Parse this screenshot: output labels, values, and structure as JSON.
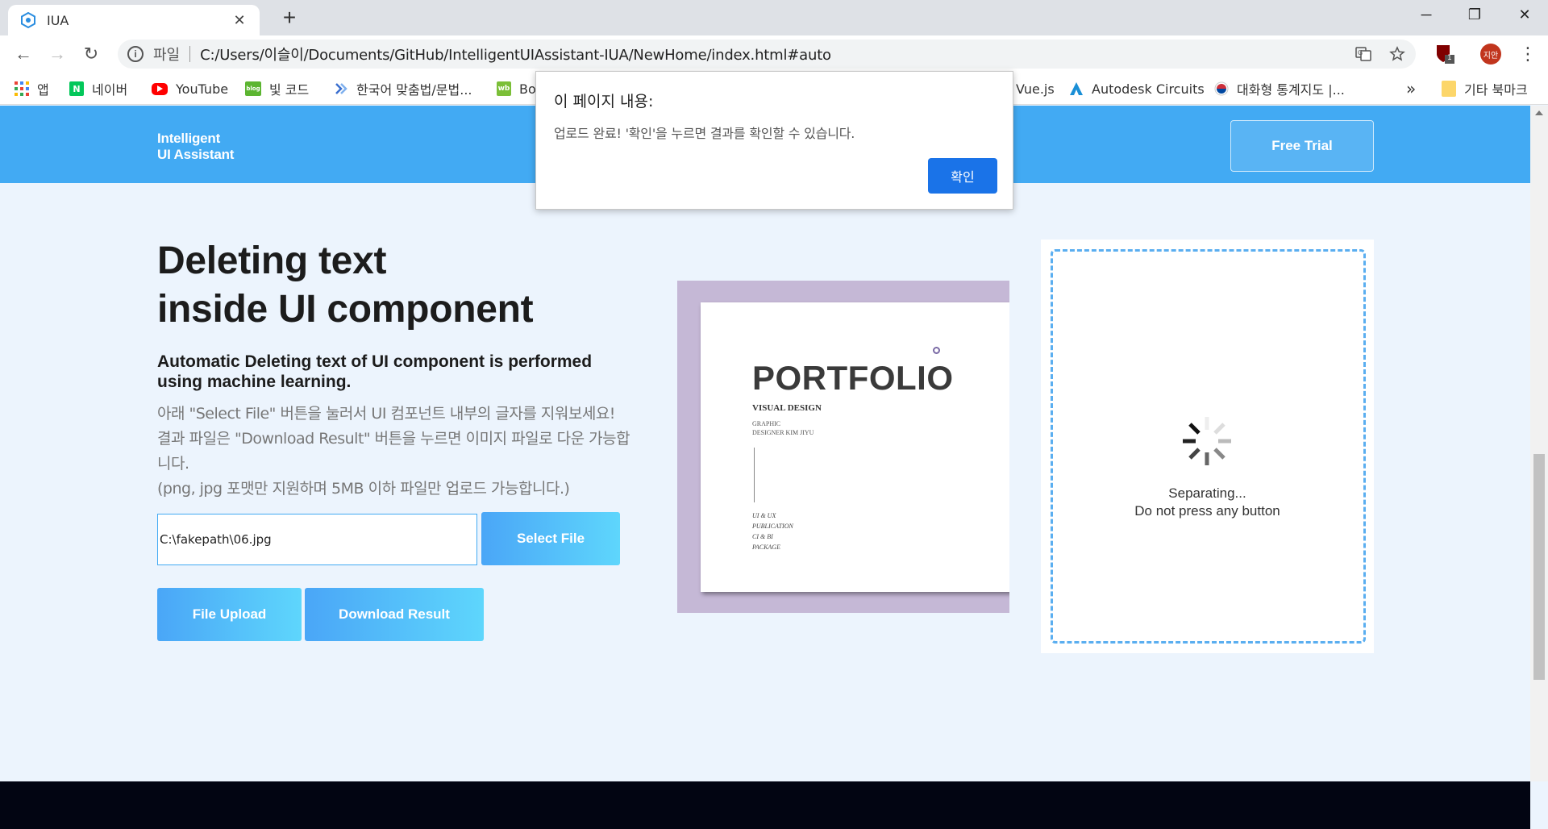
{
  "browser": {
    "tab_title": "IUA",
    "tab_close": "✕",
    "new_tab": "+",
    "window_controls": {
      "minimize": "─",
      "restore": "❐",
      "close": "✕"
    },
    "nav": {
      "back": "←",
      "forward": "→",
      "reload": "↻"
    },
    "omnibox": {
      "info_icon": "i",
      "scheme_label": "파일",
      "url": "C:/Users/이슬이/Documents/GitHub/IntelligentUIAssistant-IUA/NewHome/index.html#auto"
    },
    "extension_badge": "1",
    "profile_label": "지안",
    "menu": "⋮",
    "bookmarks": [
      {
        "label": "앱",
        "icon": "apps-grid-icon"
      },
      {
        "label": "네이버",
        "icon": "naver-icon",
        "icon_text": "N",
        "color": "#03c75a"
      },
      {
        "label": "YouTube",
        "icon": "youtube-icon",
        "color": "#ff0000"
      },
      {
        "label": "빛 코드",
        "icon": "blog-icon",
        "icon_text": "blog",
        "color": "#5cb531"
      },
      {
        "label": "한국어 맞춤법/문법...",
        "icon": "spellcheck-icon",
        "color": "#3a6ecf"
      },
      {
        "label": "Bo",
        "icon": "wb-icon",
        "icon_text": "wb",
        "color": "#7bbf38"
      },
      {
        "label": "Vue.js",
        "icon": "vue-icon"
      },
      {
        "label": "Autodesk Circuits",
        "icon": "autodesk-icon",
        "color": "#1a8fd6"
      },
      {
        "label": "대화형 통계지도 |...",
        "icon": "korea-flag-icon"
      }
    ],
    "bookmarks_overflow": "»",
    "other_bookmarks": "기타 북마크"
  },
  "header": {
    "logo_line1": "Intelligent",
    "logo_line2": "UI Assistant",
    "free_trial": "Free Trial"
  },
  "main": {
    "heading_line1": "Deleting text",
    "heading_line2": "inside UI component",
    "subheading": "Automatic Deleting text of UI component is performed using machine learning.",
    "desc_line1": "아래 \"Select File\" 버튼을 눌러서 UI 컴포넌트 내부의 글자를 지워보세요!",
    "desc_line2": "결과 파일은 \"Download Result\" 버튼을 누르면 이미지 파일로 다운 가능합니다.",
    "desc_line3": "(png, jpg 포맷만 지원하며 5MB 이하 파일만 업로드 가능합니다.)",
    "file_path": "C:\\fakepath\\06.jpg",
    "select_file": "Select File",
    "file_upload": "File Upload",
    "download_result": "Download Result"
  },
  "preview": {
    "title": "PORTFOLIO",
    "visual_design": "VISUAL DESIGN",
    "graphic": "GRAPHIC",
    "designer": "DESIGNER KIM JIYU",
    "list": [
      "UI & UX",
      "PUBLICATION",
      "CI & BI",
      "PACKAGE"
    ]
  },
  "result": {
    "status_line1": "Separating...",
    "status_line2": "Do not press any button"
  },
  "dialog": {
    "title": "이 페이지 내용:",
    "message": "업로드 완료! '확인'을 누르면 결과를 확인할 수 있습니다.",
    "ok": "확인"
  },
  "colors": {
    "header_bg": "#42aaf3",
    "page_bg": "#ecf4fd",
    "button_gradient_start": "#4aa6f7",
    "button_gradient_end": "#5ed6fc",
    "dialog_ok": "#1a73e8",
    "footer_bg": "#020512"
  }
}
